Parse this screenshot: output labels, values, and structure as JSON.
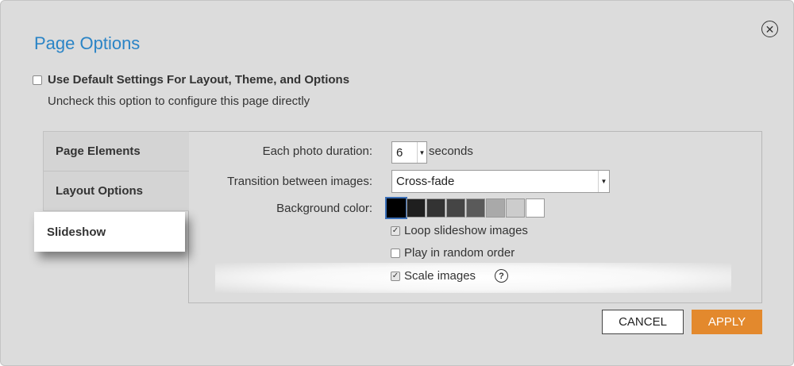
{
  "dialog": {
    "title": "Page Options",
    "close_icon": "close-icon",
    "default_settings": {
      "label": "Use Default Settings For Layout, Theme, and Options",
      "checked": false
    },
    "hint": "Uncheck this option to configure this page directly"
  },
  "tabs": [
    {
      "label": "Page Elements",
      "active": false
    },
    {
      "label": "Layout Options",
      "active": false
    },
    {
      "label": "Slideshow",
      "active": true
    }
  ],
  "slideshow": {
    "duration_label": "Each photo duration:",
    "duration_value": "6",
    "duration_unit": "seconds",
    "transition_label": "Transition between images:",
    "transition_value": "Cross-fade",
    "background_label": "Background color:",
    "swatches": [
      "#000000",
      "#1f1f1f",
      "#333333",
      "#454545",
      "#5a5a5a",
      "#a9a9a9",
      "#cccccc",
      "#ffffff"
    ],
    "selected_swatch": 0,
    "options": [
      {
        "label": "Loop slideshow images",
        "checked": true
      },
      {
        "label": "Play in random order",
        "checked": false
      },
      {
        "label": "Scale images",
        "checked": true
      }
    ],
    "help_icon": "?"
  },
  "buttons": {
    "cancel": "CANCEL",
    "apply": "APPLY"
  },
  "colors": {
    "accent": "#2a84c6",
    "apply": "#e3892d",
    "dialog_bg": "#dcdcdc"
  }
}
